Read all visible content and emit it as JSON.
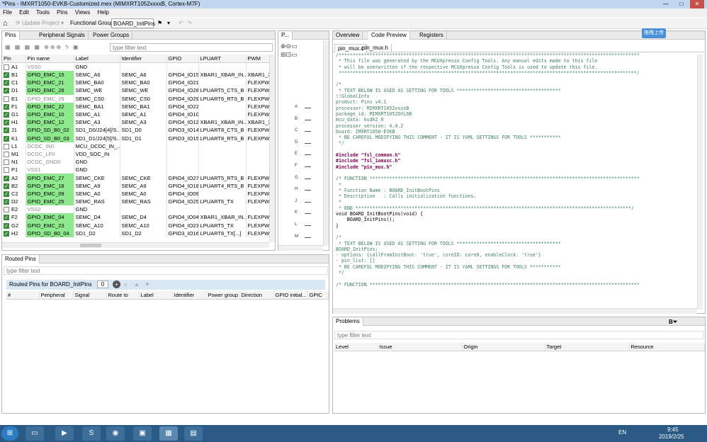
{
  "window": {
    "title": "*Pins - IMXRT1050-EVKB-Customized.mex (MIMXRT1052xxxxB, Cortex-M7F)",
    "min": "—",
    "max": "□",
    "close": "✕"
  },
  "menu": [
    "File",
    "Edit",
    "Tools",
    "Pins",
    "Views",
    "Help"
  ],
  "toolbar": {
    "update_project": "Update Project",
    "functional_group_label": "Functional Group",
    "functional_group_value": "BOARD_InitPins"
  },
  "pins_panel": {
    "tabs": [
      "Pins",
      "Peripheral Signals",
      "Power Groups"
    ],
    "filter_placeholder": "type filter text",
    "columns": [
      "Pin",
      "Pin name",
      "Label",
      "Identifier",
      "GPIO",
      "LPUART",
      "PWM"
    ],
    "rows": [
      {
        "pin": "A1",
        "checked": false,
        "name": "VSS0",
        "label": "GND",
        "id": "",
        "gpio": "",
        "lpuart": "",
        "pwm": "",
        "green": false,
        "gray": true
      },
      {
        "pin": "B1",
        "checked": true,
        "name": "GPIO_EMC_15",
        "label": "SEMC_A6",
        "id": "SEMC_A6",
        "gpio": "GPIO4_IO15",
        "lpuart": "XBAR1_XBAR_IN...",
        "pwm": "XBAR1_X",
        "green": true,
        "gray": false
      },
      {
        "pin": "C1",
        "checked": true,
        "name": "GPIO_EMC_21",
        "label": "SEMC_BA0",
        "id": "SEMC_BA0",
        "gpio": "GPIO4_IO21",
        "lpuart": "",
        "pwm": "FLEXPWI",
        "green": true,
        "gray": false
      },
      {
        "pin": "D1",
        "checked": true,
        "name": "GPIO_EMC_28",
        "label": "SEMC_WE",
        "id": "SEMC_WE",
        "gpio": "GPIO4_IO28",
        "lpuart": "LPUART5_CTS_B",
        "pwm": "FLEXPWI",
        "green": true,
        "gray": false
      },
      {
        "pin": "E1",
        "checked": false,
        "name": "GPIO_EMC_29",
        "label": "SEMC_CS0",
        "id": "SEMC_CS0",
        "gpio": "GPIO4_IO29",
        "lpuart": "LPUART6_RTS_B",
        "pwm": "FLEXPWI",
        "green": false,
        "gray": true
      },
      {
        "pin": "F1",
        "checked": true,
        "name": "GPIO_EMC_22",
        "label": "SEMC_BA1",
        "id": "SEMC_BA1",
        "gpio": "GPIO4_IO22",
        "lpuart": "",
        "pwm": "FLEXPWI",
        "green": true,
        "gray": false
      },
      {
        "pin": "G1",
        "checked": true,
        "name": "GPIO_EMC_10",
        "label": "SEMC_A1",
        "id": "SEMC_A1",
        "gpio": "GPIO4_IO10",
        "lpuart": "",
        "pwm": "FLEXPWI",
        "green": true,
        "gray": false
      },
      {
        "pin": "H1",
        "checked": true,
        "name": "GPIO_EMC_12",
        "label": "SEMC_A3",
        "id": "SEMC_A3",
        "gpio": "GPIO4_IO12",
        "lpuart": "XBAR1_XBAR_IN...",
        "pwm": "XBAR1_X",
        "green": true,
        "gray": false
      },
      {
        "pin": "J1",
        "checked": true,
        "name": "GPIO_SD_B0_02",
        "label": "SD1_D0/J24[4]/S...",
        "id": "SD1_D0",
        "gpio": "GPIO3_IO14",
        "lpuart": "LPUART8_CTS_B",
        "pwm": "FLEXPWI",
        "green": true,
        "gray": false
      },
      {
        "pin": "K1",
        "checked": true,
        "name": "GPIO_SD_B0_03",
        "label": "SD1_D1/J24[5]/S...",
        "id": "SD1_D1",
        "gpio": "GPIO3_IO15",
        "lpuart": "LPUART8_RTS_B",
        "pwm": "FLEXPWI",
        "green": true,
        "gray": false
      },
      {
        "pin": "L1",
        "checked": false,
        "name": "DCDC_IN0",
        "label": "MCU_DCDC_IN_...",
        "id": "",
        "gpio": "",
        "lpuart": "",
        "pwm": "",
        "green": false,
        "gray": true
      },
      {
        "pin": "M1",
        "checked": false,
        "name": "DCDC_LP0",
        "label": "VDD_SOC_IN",
        "id": "",
        "gpio": "",
        "lpuart": "",
        "pwm": "",
        "green": false,
        "gray": true
      },
      {
        "pin": "N1",
        "checked": false,
        "name": "DCDC_GND0",
        "label": "GND",
        "id": "",
        "gpio": "",
        "lpuart": "",
        "pwm": "",
        "green": false,
        "gray": true
      },
      {
        "pin": "P1",
        "checked": false,
        "name": "VSS1",
        "label": "GND",
        "id": "",
        "gpio": "",
        "lpuart": "",
        "pwm": "",
        "green": false,
        "gray": true
      },
      {
        "pin": "A2",
        "checked": true,
        "name": "GPIO_EMC_27",
        "label": "SEMC_CKE",
        "id": "SEMC_CKE",
        "gpio": "GPIO4_IO27",
        "lpuart": "LPUART5_RTS_B",
        "pwm": "FLEXPWI",
        "green": true,
        "gray": false
      },
      {
        "pin": "B2",
        "checked": true,
        "name": "GPIO_EMC_18",
        "label": "SEMC_A9",
        "id": "SEMC_A9",
        "gpio": "GPIO4_IO18",
        "lpuart": "LPUART4_RTS_B",
        "pwm": "FLEXPWI",
        "green": true,
        "gray": false
      },
      {
        "pin": "C2",
        "checked": true,
        "name": "GPIO_EMC_09",
        "label": "SEMC_A0",
        "id": "SEMC_A0",
        "gpio": "GPIO4_IO09",
        "lpuart": "",
        "pwm": "FLEXPWI",
        "green": true,
        "gray": false
      },
      {
        "pin": "D2",
        "checked": true,
        "name": "GPIO_EMC_25",
        "label": "SEMC_RAS",
        "id": "SEMC_RAS",
        "gpio": "GPIO4_IO25",
        "lpuart": "LPUART6_TX",
        "pwm": "FLEXPWI",
        "green": true,
        "gray": false
      },
      {
        "pin": "E2",
        "checked": false,
        "name": "VSS2",
        "label": "GND",
        "id": "",
        "gpio": "",
        "lpuart": "",
        "pwm": "",
        "green": false,
        "gray": true
      },
      {
        "pin": "F2",
        "checked": true,
        "name": "GPIO_EMC_04",
        "label": "SEMC_D4",
        "id": "SEMC_D4",
        "gpio": "GPIO4_IO04",
        "lpuart": "XBAR1_XBAR_IN...",
        "pwm": "FLEXPWI",
        "green": true,
        "gray": false
      },
      {
        "pin": "G2",
        "checked": true,
        "name": "GPIO_EMC_23",
        "label": "SEMC_A10",
        "id": "SEMC_A10",
        "gpio": "GPIO4_IO23",
        "lpuart": "LPUART5_TX",
        "pwm": "FLEXPWI",
        "green": true,
        "gray": false
      },
      {
        "pin": "H2",
        "checked": true,
        "name": "GPIO_SD_B0_04",
        "label": "SD1_D2",
        "id": "SD1_D2",
        "gpio": "GPIO3_IO16",
        "lpuart": "LPUART8_TX[...]",
        "pwm": "FLEXPWI",
        "green": true,
        "gray": false
      }
    ]
  },
  "package_panel": {
    "tab": "P...",
    "labels": [
      "A",
      "B",
      "C",
      "D",
      "E",
      "F",
      "G",
      "H",
      "J",
      "K",
      "L",
      "M"
    ]
  },
  "routed_panel": {
    "tab": "Routed Pins",
    "filter_placeholder": "type filter text",
    "heading": "Routed Pins for BOARD_InitPins",
    "count": "0",
    "columns": [
      "#",
      "Peripheral",
      "Signal",
      "Route to",
      "Label",
      "Identifier",
      "Power group",
      "Direction",
      "GPIO initial...",
      "GPIC"
    ]
  },
  "editor": {
    "tabs": [
      "Overview",
      "Code Preview",
      "Registers"
    ],
    "file_tabs": [
      "pin_mux.c",
      "pin_mux.h"
    ],
    "cloud_button": "拖拽上传",
    "lines": [
      {
        "t": "/***********************************************************************************************************",
        "c": "cm"
      },
      {
        "t": " * This file was generated by the MCUXpresso Config Tools. Any manual edits made to this file",
        "c": "cm"
      },
      {
        "t": " * will be overwritten if the respective MCUXpresso Config Tools is used to update this file.",
        "c": "cm"
      },
      {
        "t": " **********************************************************************************************************/",
        "c": "cm"
      },
      {
        "t": "",
        "c": "cm"
      },
      {
        "t": "/*",
        "c": "cm"
      },
      {
        "t": " * TEXT BELOW IS USED AS SETTING FOR TOOLS *************************************",
        "c": "cm"
      },
      {
        "t": "!!GlobalInfo",
        "c": "cm"
      },
      {
        "t": "product: Pins v4.1",
        "c": "cm"
      },
      {
        "t": "processor: MIMXRT1052xxxxB",
        "c": "cm"
      },
      {
        "t": "package_id: MIMXRT1052DVL6B",
        "c": "cm"
      },
      {
        "t": "mcu_data: ksdk2_0",
        "c": "cm"
      },
      {
        "t": "processor_version: 4.0.2",
        "c": "cm"
      },
      {
        "t": "board: IMXRT1050-EVKB",
        "c": "cm"
      },
      {
        "t": " * BE CAREFUL MODIFYING THIS COMMENT - IT IS YAML SETTINGS FOR TOOLS ***********",
        "c": "cm"
      },
      {
        "t": " */",
        "c": "cm"
      },
      {
        "t": "",
        "c": "cm"
      },
      {
        "t": "#include \"fsl_common.h\"",
        "c": "inc"
      },
      {
        "t": "#include \"fsl_iomuxc.h\"",
        "c": "inc"
      },
      {
        "t": "#include \"pin_mux.h\"",
        "c": "inc"
      },
      {
        "t": "",
        "c": "cm"
      },
      {
        "t": "/* FUNCTION ************************************************************************************************",
        "c": "cm"
      },
      {
        "t": " *",
        "c": "cm"
      },
      {
        "t": " * Function Name : BOARD_InitBootPins",
        "c": "cm"
      },
      {
        "t": " * Description   : Calls initialization functions.",
        "c": "cm"
      },
      {
        "t": " *",
        "c": "cm"
      },
      {
        "t": " * END **************************************************************************************************/",
        "c": "cm"
      },
      {
        "t": "void BOARD_InitBootPins(void) {",
        "c": "code"
      },
      {
        "t": "    BOARD_InitPins();",
        "c": "code"
      },
      {
        "t": "}",
        "c": "code"
      },
      {
        "t": "",
        "c": "cm"
      },
      {
        "t": "/*",
        "c": "cm"
      },
      {
        "t": " * TEXT BELOW IS USED AS SETTING FOR TOOLS *************************************",
        "c": "cm"
      },
      {
        "t": "BOARD_InitPins:",
        "c": "cm"
      },
      {
        "t": "- options: {callFromInitBoot: 'true', coreID: core0, enableClock: 'true'}",
        "c": "cm"
      },
      {
        "t": "- pin_list: []",
        "c": "cm"
      },
      {
        "t": " * BE CAREFUL MODIFYING THIS COMMENT - IT IS YAML SETTINGS FOR TOOLS ***********",
        "c": "cm"
      },
      {
        "t": " */",
        "c": "cm"
      },
      {
        "t": "",
        "c": "cm"
      },
      {
        "t": "/* FUNCTION ************************************************************************************************",
        "c": "cm"
      }
    ]
  },
  "problems": {
    "tab": "Problems",
    "filter_placeholder": "type filter text",
    "columns": [
      "Level",
      "Issue",
      "Origin",
      "Target",
      "Resource"
    ]
  },
  "taskbar": {
    "lang": "EN",
    "time": "9:45",
    "date": "2019/2/25"
  },
  "colors": {
    "assigned": "#8ee88e",
    "title": "#c2d7ef",
    "taskbar": "#2b5a85"
  }
}
